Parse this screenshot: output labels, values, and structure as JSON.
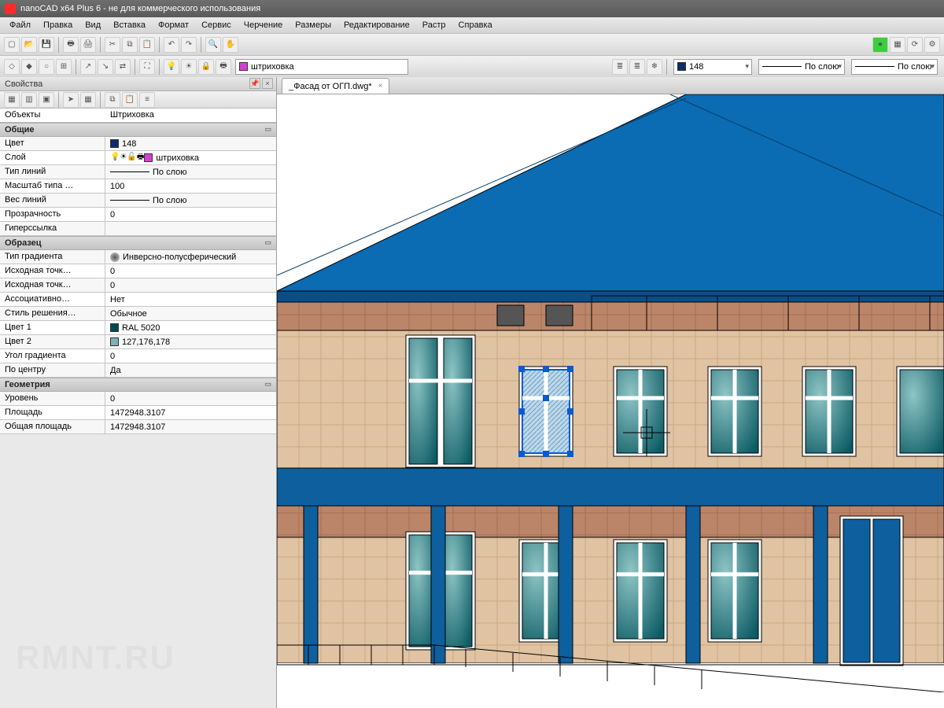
{
  "title": "nanoCAD x64 Plus 6 - не для коммерческого использования",
  "menu": [
    "Файл",
    "Правка",
    "Вид",
    "Вставка",
    "Формат",
    "Сервис",
    "Черчение",
    "Размеры",
    "Редактирование",
    "Растр",
    "Справка"
  ],
  "layer_active": "штриховка",
  "color_active_label": "148",
  "linetype_label": "По слою",
  "lineweight_label": "По слою",
  "doc_tab": "_Фасад от ОГП.dwg*",
  "panel_title": "Свойства",
  "selector": {
    "label": "Объекты",
    "value": "Штриховка"
  },
  "sections": {
    "general": "Общие",
    "pattern": "Образец",
    "geometry": "Геометрия"
  },
  "props": {
    "color": {
      "label": "Цвет",
      "value": "148",
      "swatch": "#0c2c6a"
    },
    "layer": {
      "label": "Слой",
      "value": "штриховка",
      "swatch": "#d63fd6"
    },
    "linetype": {
      "label": "Тип линий",
      "value": "По слою"
    },
    "ltscale": {
      "label": "Масштаб типа …",
      "value": "100"
    },
    "lineweight": {
      "label": "Вес линий",
      "value": "По слою"
    },
    "transparency": {
      "label": "Прозрачность",
      "value": "0"
    },
    "hyperlink": {
      "label": "Гиперссылка",
      "value": ""
    },
    "gradtype": {
      "label": "Тип градиента",
      "value": "Инверсно-полусферический"
    },
    "origin1": {
      "label": "Исходная точк…",
      "value": "0"
    },
    "origin2": {
      "label": "Исходная точк…",
      "value": "0"
    },
    "assoc": {
      "label": "Ассоциативно…",
      "value": "Нет"
    },
    "style": {
      "label": "Стиль решения…",
      "value": "Обычное"
    },
    "color1": {
      "label": "Цвет 1",
      "value": "RAL 5020",
      "swatch": "#004a55"
    },
    "color2": {
      "label": "Цвет 2",
      "value": "127,176,178",
      "swatch": "#7fb0b2"
    },
    "angle": {
      "label": "Угол градиента",
      "value": "0"
    },
    "center": {
      "label": "По центру",
      "value": "Да"
    },
    "elevation": {
      "label": "Уровень",
      "value": "0"
    },
    "area": {
      "label": "Площадь",
      "value": "1472948.3107"
    },
    "totalarea": {
      "label": "Общая площадь",
      "value": "1472948.3107"
    }
  },
  "colors": {
    "roof": "#0b6bb3",
    "roof_dark": "#0a4e86",
    "wall_tan": "#e0c3a2",
    "wall_brown": "#bb8569",
    "band_blue": "#0e5f9e",
    "window_glass_a": "#0b5b64",
    "window_glass_b": "#8fc5c5",
    "frame": "#ffffff",
    "line": "#000000",
    "sel_hatch": "#bcd7e8"
  },
  "watermark": "RMNT.RU"
}
